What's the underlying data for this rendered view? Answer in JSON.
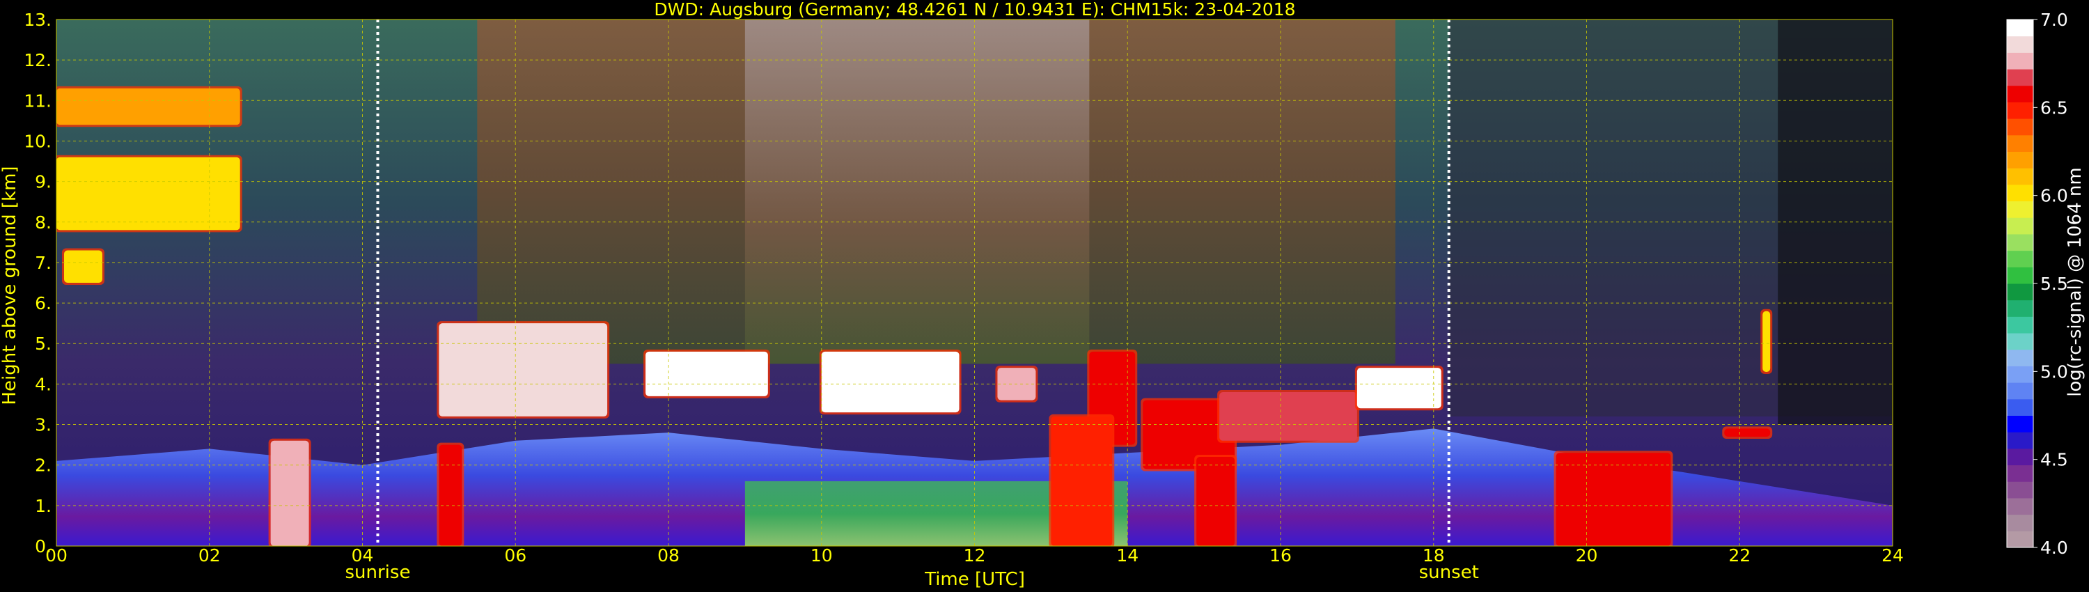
{
  "chart_data": {
    "type": "heatmap",
    "title": "DWD: Augsburg (Germany; 48.4261 N / 10.9431 E):    CHM15k: 23-04-2018",
    "xlabel": "Time [UTC]",
    "ylabel": "Height above ground [km]",
    "xlim": [
      0,
      24
    ],
    "ylim": [
      0,
      13
    ],
    "x_ticks": [
      0,
      2,
      4,
      6,
      8,
      10,
      12,
      14,
      16,
      18,
      20,
      22,
      24
    ],
    "x_tick_labels": [
      "00",
      "02",
      "04",
      "06",
      "08",
      "10",
      "12",
      "14",
      "16",
      "18",
      "20",
      "22",
      "24"
    ],
    "y_ticks": [
      0,
      1,
      2,
      3,
      4,
      5,
      6,
      7,
      8,
      9,
      10,
      11,
      12,
      13
    ],
    "y_tick_labels": [
      "0.",
      "1.",
      "2.",
      "3.",
      "4.",
      "5.",
      "6.",
      "7.",
      "8.",
      "9.",
      "10.",
      "11.",
      "12.",
      "13."
    ],
    "grid": true,
    "grid_color": "#c8c800",
    "text_color": "#ffff00",
    "background": "#000000",
    "events": [
      {
        "label": "sunrise",
        "time": 4.2
      },
      {
        "label": "sunset",
        "time": 18.2
      }
    ],
    "colorbar": {
      "label": "log(rc-signal) @ 1064 nm",
      "range": [
        4.0,
        7.0
      ],
      "ticks": [
        4.0,
        4.5,
        5.0,
        5.5,
        6.0,
        6.5,
        7.0
      ],
      "tick_labels": [
        "4.0",
        "4.5",
        "5.0",
        "5.5",
        "6.0",
        "6.5",
        "7.0"
      ],
      "colors": [
        "#b49aa5",
        "#a88b9f",
        "#9c6f99",
        "#8a4e93",
        "#7a2f92",
        "#5a1aa0",
        "#2a1ac8",
        "#0000ff",
        "#3a5cf0",
        "#5f83f3",
        "#7aa0f5",
        "#8fb8f0",
        "#6cd2c8",
        "#3cc8a0",
        "#20b070",
        "#109840",
        "#30c040",
        "#60d050",
        "#9ae060",
        "#c8ee50",
        "#eef030",
        "#ffe000",
        "#ffc000",
        "#ffa000",
        "#ff8000",
        "#ff5000",
        "#ff2000",
        "#ee0000",
        "#e04050",
        "#f0b0b8",
        "#f2dada",
        "#ffffff"
      ]
    },
    "cloud_layers": [
      {
        "t0": 0.0,
        "t1": 2.4,
        "h0": 10.4,
        "h1": 11.3,
        "level": 6.2
      },
      {
        "t0": 0.0,
        "t1": 2.4,
        "h0": 7.8,
        "h1": 9.6,
        "level": 6.0
      },
      {
        "t0": 0.1,
        "t1": 0.6,
        "h0": 6.5,
        "h1": 7.3,
        "level": 6.0
      },
      {
        "t0": 5.0,
        "t1": 7.2,
        "h0": 3.2,
        "h1": 5.5,
        "level": 6.9
      },
      {
        "t0": 7.7,
        "t1": 9.3,
        "h0": 3.7,
        "h1": 4.8,
        "level": 7.0
      },
      {
        "t0": 10.0,
        "t1": 11.8,
        "h0": 3.3,
        "h1": 4.8,
        "level": 7.0
      },
      {
        "t0": 12.3,
        "t1": 12.8,
        "h0": 3.6,
        "h1": 4.4,
        "level": 6.8
      },
      {
        "t0": 13.5,
        "t1": 14.1,
        "h0": 2.5,
        "h1": 4.8,
        "level": 6.6
      },
      {
        "t0": 14.2,
        "t1": 15.4,
        "h0": 1.9,
        "h1": 3.6,
        "level": 6.6
      },
      {
        "t0": 15.2,
        "t1": 17.0,
        "h0": 2.6,
        "h1": 3.8,
        "level": 6.7
      },
      {
        "t0": 17.0,
        "t1": 18.1,
        "h0": 3.4,
        "h1": 4.4,
        "level": 7.0
      },
      {
        "t0": 19.6,
        "t1": 21.1,
        "h0": 0.0,
        "h1": 2.3,
        "level": 6.6
      },
      {
        "t0": 21.8,
        "t1": 22.4,
        "h0": 2.7,
        "h1": 2.9,
        "level": 6.6
      },
      {
        "t0": 22.3,
        "t1": 22.4,
        "h0": 4.3,
        "h1": 5.8,
        "level": 6.0
      },
      {
        "t0": 2.8,
        "t1": 3.3,
        "h0": 0.0,
        "h1": 2.6,
        "level": 6.8
      },
      {
        "t0": 5.0,
        "t1": 5.3,
        "h0": 0.0,
        "h1": 2.5,
        "level": 6.6
      },
      {
        "t0": 13.0,
        "t1": 13.8,
        "h0": 0.0,
        "h1": 3.2,
        "level": 6.5
      },
      {
        "t0": 14.9,
        "t1": 15.4,
        "h0": 0.0,
        "h1": 2.2,
        "level": 6.6
      }
    ],
    "boundary_layer": [
      {
        "time": 0,
        "top": 2.1
      },
      {
        "time": 2,
        "top": 2.4
      },
      {
        "time": 4,
        "top": 2.0
      },
      {
        "time": 6,
        "top": 2.6
      },
      {
        "time": 8,
        "top": 2.8
      },
      {
        "time": 10,
        "top": 2.4
      },
      {
        "time": 12,
        "top": 2.1
      },
      {
        "time": 14,
        "top": 2.3
      },
      {
        "time": 16,
        "top": 2.5
      },
      {
        "time": 18,
        "top": 2.9
      },
      {
        "time": 20,
        "top": 2.2
      },
      {
        "time": 22,
        "top": 1.6
      },
      {
        "time": 24,
        "top": 1.0
      }
    ]
  }
}
